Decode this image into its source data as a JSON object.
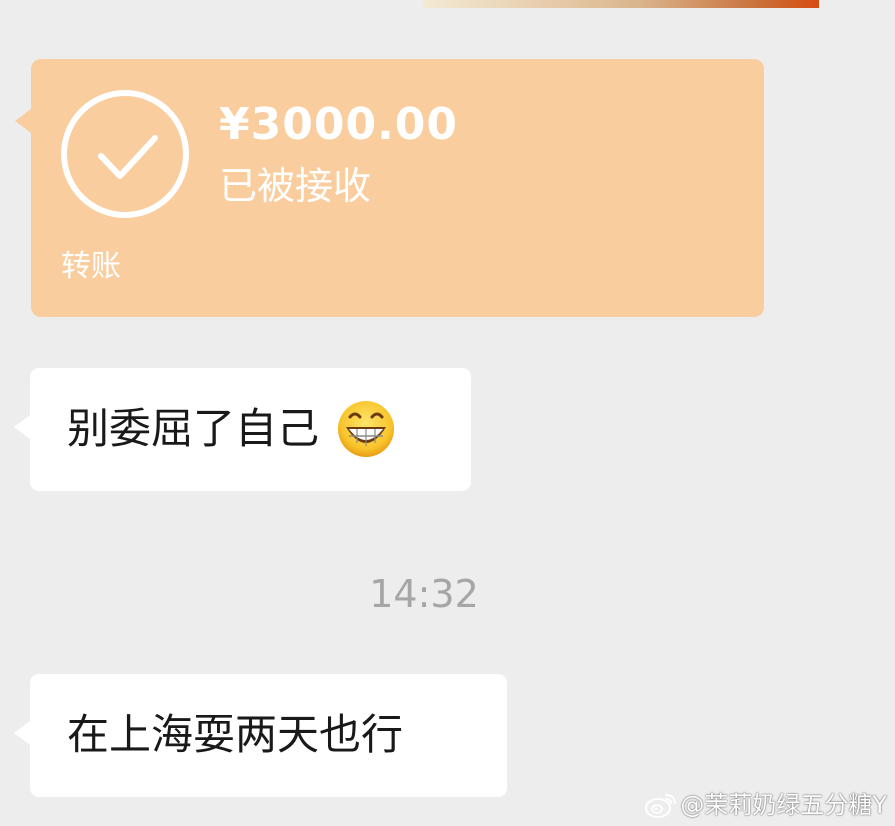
{
  "transfer": {
    "amount": "¥3000.00",
    "status": "已被接收",
    "type_label": "转账",
    "icon": "check-circle-icon",
    "bg_color": "#facd9e"
  },
  "messages": [
    {
      "text": "别委屈了自己",
      "emoji": "grinning-face-icon"
    },
    {
      "text": "在上海耍两天也行"
    }
  ],
  "timestamp": "14:32",
  "watermark": {
    "text": "@茉莉奶绿五分糖Y",
    "icon": "weibo-icon"
  },
  "colors": {
    "background": "#ededed",
    "bubble": "#ffffff",
    "timestamp": "#a6a6a6"
  }
}
